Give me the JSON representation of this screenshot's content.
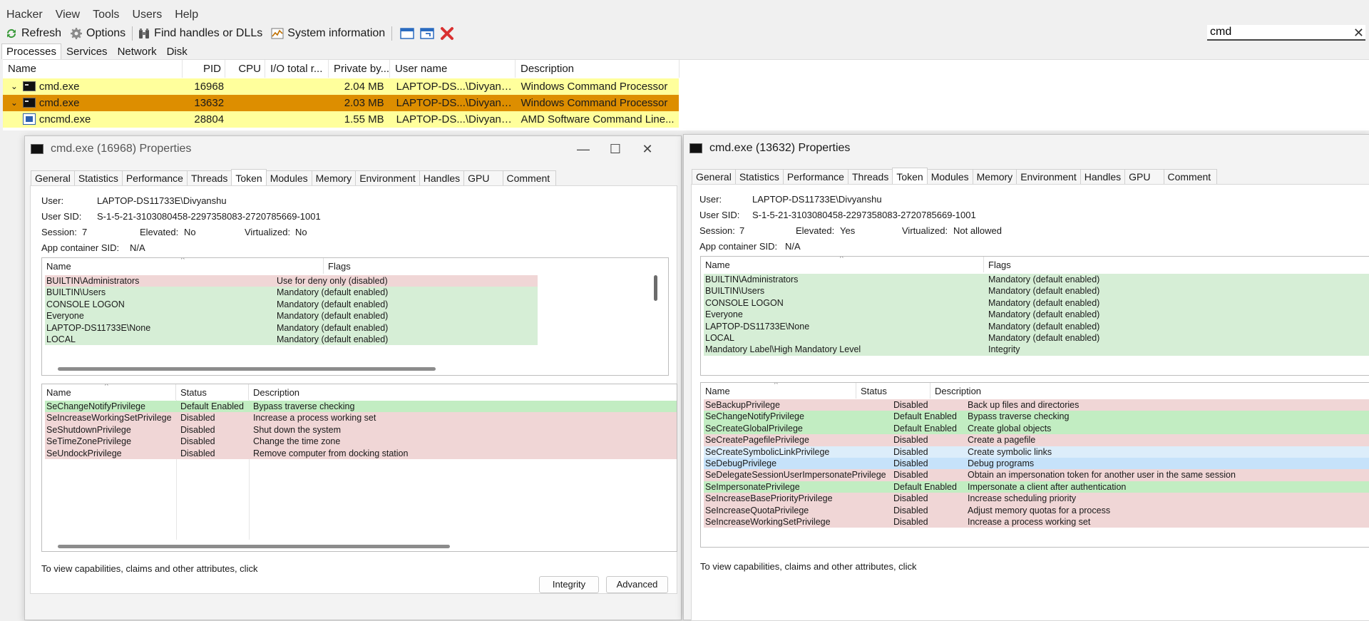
{
  "menu": [
    "Hacker",
    "View",
    "Tools",
    "Users",
    "Help"
  ],
  "toolbar": {
    "refresh": "Refresh",
    "options": "Options",
    "find_handles": "Find handles or DLLs",
    "system_info": "System information"
  },
  "search": {
    "value": "cmd",
    "clear": "✕"
  },
  "main_tabs": [
    "Processes",
    "Services",
    "Network",
    "Disk"
  ],
  "process_columns": [
    "Name",
    "PID",
    "CPU",
    "I/O total r...",
    "Private by...",
    "User name",
    "Description"
  ],
  "processes": [
    {
      "name": "cmd.exe",
      "pid": "16968",
      "cpu": "",
      "io": "",
      "private": "2.04 MB",
      "user": "LAPTOP-DS...\\Divyanshu",
      "desc": "Windows Command Processor"
    },
    {
      "name": "cmd.exe",
      "pid": "13632",
      "cpu": "",
      "io": "",
      "private": "2.03 MB",
      "user": "LAPTOP-DS...\\Divyanshu",
      "desc": "Windows Command Processor"
    },
    {
      "name": "cncmd.exe",
      "pid": "28804",
      "cpu": "",
      "io": "",
      "private": "1.55 MB",
      "user": "LAPTOP-DS...\\Divyanshu",
      "desc": "AMD Software Command Line..."
    }
  ],
  "dialog_left": {
    "title": "cmd.exe (16968) Properties",
    "tabs": [
      "General",
      "Statistics",
      "Performance",
      "Threads",
      "Token",
      "Modules",
      "Memory",
      "Environment",
      "Handles",
      "GPU",
      "Comment"
    ],
    "user_label": "User:",
    "user": "LAPTOP-DS11733E\\Divyanshu",
    "sid_label": "User SID:",
    "sid": "S-1-5-21-3103080458-2297358083-2720785669-1001",
    "session_label": "Session:",
    "session": "7",
    "elevated_label": "Elevated:",
    "elevated": "No",
    "virtualized_label": "Virtualized:",
    "virtualized": "No",
    "container_label": "App container SID:",
    "container": "N/A",
    "groups_header": [
      "Name",
      "Flags"
    ],
    "groups": [
      {
        "name": "BUILTIN\\Administrators",
        "flags": "Use for deny only (disabled)",
        "tone": "pink"
      },
      {
        "name": "BUILTIN\\Users",
        "flags": "Mandatory (default enabled)",
        "tone": "green"
      },
      {
        "name": "CONSOLE LOGON",
        "flags": "Mandatory (default enabled)",
        "tone": "green"
      },
      {
        "name": "Everyone",
        "flags": "Mandatory (default enabled)",
        "tone": "green"
      },
      {
        "name": "LAPTOP-DS11733E\\None",
        "flags": "Mandatory (default enabled)",
        "tone": "green"
      },
      {
        "name": "LOCAL",
        "flags": "Mandatory (default enabled)",
        "tone": "green"
      }
    ],
    "privs_header": [
      "Name",
      "Status",
      "Description"
    ],
    "privileges": [
      {
        "name": "SeChangeNotifyPrivilege",
        "status": "Default Enabled",
        "desc": "Bypass traverse checking",
        "tone": "bgreen"
      },
      {
        "name": "SeIncreaseWorkingSetPrivilege",
        "status": "Disabled",
        "desc": "Increase a process working set",
        "tone": "pink"
      },
      {
        "name": "SeShutdownPrivilege",
        "status": "Disabled",
        "desc": "Shut down the system",
        "tone": "pink"
      },
      {
        "name": "SeTimeZonePrivilege",
        "status": "Disabled",
        "desc": "Change the time zone",
        "tone": "pink"
      },
      {
        "name": "SeUndockPrivilege",
        "status": "Disabled",
        "desc": "Remove computer from docking station",
        "tone": "pink"
      }
    ],
    "footer": "To view capabilities, claims and other attributes, click",
    "integrity_button": "Integrity",
    "advanced_button": "Advanced",
    "minimize": "—",
    "maximize": "☐",
    "close": "✕"
  },
  "dialog_right": {
    "title": "cmd.exe (13632) Properties",
    "tabs": [
      "General",
      "Statistics",
      "Performance",
      "Threads",
      "Token",
      "Modules",
      "Memory",
      "Environment",
      "Handles",
      "GPU",
      "Comment"
    ],
    "user_label": "User:",
    "user": "LAPTOP-DS11733E\\Divyanshu",
    "sid_label": "User SID:",
    "sid": "S-1-5-21-3103080458-2297358083-2720785669-1001",
    "session_label": "Session:",
    "session": "7",
    "elevated_label": "Elevated:",
    "elevated": "Yes",
    "virtualized_label": "Virtualized:",
    "virtualized": "Not allowed",
    "container_label": "App container SID:",
    "container": "N/A",
    "groups_header": [
      "Name",
      "Flags"
    ],
    "groups": [
      {
        "name": "BUILTIN\\Administrators",
        "flags": "Mandatory (default enabled)",
        "tone": "green"
      },
      {
        "name": "BUILTIN\\Users",
        "flags": "Mandatory (default enabled)",
        "tone": "green"
      },
      {
        "name": "CONSOLE LOGON",
        "flags": "Mandatory (default enabled)",
        "tone": "green"
      },
      {
        "name": "Everyone",
        "flags": "Mandatory (default enabled)",
        "tone": "green"
      },
      {
        "name": "LAPTOP-DS11733E\\None",
        "flags": "Mandatory (default enabled)",
        "tone": "green"
      },
      {
        "name": "LOCAL",
        "flags": "Mandatory (default enabled)",
        "tone": "green"
      },
      {
        "name": "Mandatory Label\\High Mandatory Level",
        "flags": "Integrity",
        "tone": "green"
      }
    ],
    "privs_header": [
      "Name",
      "Status",
      "Description"
    ],
    "privileges": [
      {
        "name": "SeBackupPrivilege",
        "status": "Disabled",
        "desc": "Back up files and directories",
        "tone": "pink"
      },
      {
        "name": "SeChangeNotifyPrivilege",
        "status": "Default Enabled",
        "desc": "Bypass traverse checking",
        "tone": "bgreen"
      },
      {
        "name": "SeCreateGlobalPrivilege",
        "status": "Default Enabled",
        "desc": "Create global objects",
        "tone": "bgreen"
      },
      {
        "name": "SeCreatePagefilePrivilege",
        "status": "Disabled",
        "desc": "Create a pagefile",
        "tone": "pink"
      },
      {
        "name": "SeCreateSymbolicLinkPrivilege",
        "status": "Disabled",
        "desc": "Create symbolic links",
        "tone": "lblue"
      },
      {
        "name": "SeDebugPrivilege",
        "status": "Disabled",
        "desc": "Debug programs",
        "tone": "blue"
      },
      {
        "name": "SeDelegateSessionUserImpersonatePrivilege",
        "status": "Disabled",
        "desc": "Obtain an impersonation token for another user in the same session",
        "tone": "pink"
      },
      {
        "name": "SeImpersonatePrivilege",
        "status": "Default Enabled",
        "desc": "Impersonate a client after authentication",
        "tone": "bgreen"
      },
      {
        "name": "SeIncreaseBasePriorityPrivilege",
        "status": "Disabled",
        "desc": "Increase scheduling priority",
        "tone": "pink"
      },
      {
        "name": "SeIncreaseQuotaPrivilege",
        "status": "Disabled",
        "desc": "Adjust memory quotas for a process",
        "tone": "pink"
      },
      {
        "name": "SeIncreaseWorkingSetPrivilege",
        "status": "Disabled",
        "desc": "Increase a process working set",
        "tone": "pink"
      }
    ],
    "footer": "To view capabilities, claims and other attributes, click"
  },
  "colors": {
    "process_highlight": "#ffff9c",
    "process_selected": "#dd8e00",
    "pink": "#f0d6d6",
    "green": "#d6eed6",
    "bright_green": "#c2edc2",
    "light_blue": "#dcedfa",
    "blue": "#c6e2fa"
  }
}
